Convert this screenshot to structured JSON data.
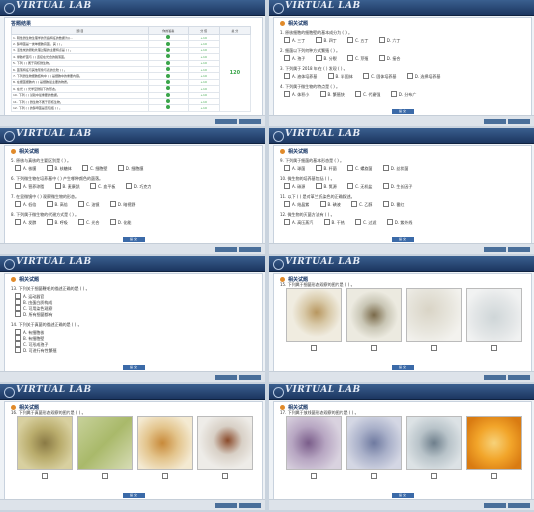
{
  "brand": {
    "logo_text": "VIRTUAL LAB"
  },
  "section_title": "相关试题",
  "submit_label": "提 交",
  "results": {
    "title": "答题结果",
    "headers": [
      "题 目",
      "你的答案",
      "分 值",
      "总 分"
    ],
    "rows": [
      "1. 阴性微生物生理学的普遍特征的数据为()...",
      "2. 酵母菌是一类单细胞真菌，其 ( ) 。",
      "3. 活性炭的颗粒处理过程的主要特点是 ( ) 。",
      "4. 绿脓杆菌与 ( ) 连接在光合的脱落菌。",
      "5. 下列 ( ) 属于真核微生物。",
      "6. 菌落特征与其他现象与表的比较 ( ) 。",
      "7. 下列微生物细胞结构中 ( ) 是细胞中的重要内容。",
      "8. 在细菌细胞内 ( ) 是细胞最主要的物质。",
      "9. 在光 ( ) 光学显微镜下的形态。",
      "10. 下列 ( ) 试验中最重要的数据。",
      "11. 下列 ( ) 微生物不属于原核生物。",
      "12. 下列 ( ) 的酵母菌是否包括 ( ) 。"
    ],
    "score_each": "+10",
    "total": "120"
  },
  "p2": {
    "questions": [
      {
        "text": "1. 原核细胞的细胞壁的基本成分为 ( ) 。",
        "options": [
          "A. 三丁",
          "B. 四丁",
          "C. 五丁",
          "D. 六丁"
        ]
      },
      {
        "text": "2. 细菌以下列何种方式繁殖 ( ) 。",
        "options": [
          "A. 孢子",
          "B. 分裂",
          "C. 芽殖",
          "D. 接合"
        ]
      },
      {
        "text": "3. 下列属于 2018 年在 ( ) 发现 ( ) 。",
        "options": [
          "A. 液体培养基",
          "B. 半固体",
          "C. 固体培养基",
          "D. 选择培养基"
        ]
      },
      {
        "text": "4. 下列属于微生物的特点是 ( ) 。",
        "options": [
          "A. 体积小",
          "B. 繁殖快",
          "C. 代谢强",
          "D. 分布广"
        ]
      }
    ]
  },
  "p3": {
    "questions": [
      {
        "text": "5. 原核与真核的主要区别是 ( ) 。",
        "options": [
          "A. 核膜",
          "B. 核糖体",
          "C. 细胞壁",
          "D. 细胞膜"
        ]
      },
      {
        "text": "6. 下列微生物在培养基中 ( ) 产生哪种颜色的菌落。",
        "options": [
          "A. 营养琼脂",
          "B. 麦康凯",
          "C. 血平板",
          "D. 巧克力"
        ]
      },
      {
        "text": "7. 在显微镜中 ( ) 观察微生物的形态。",
        "options": [
          "A. 低倍",
          "B. 高倍",
          "C. 油镜",
          "D. 暗视野"
        ]
      },
      {
        "text": "8. 下列属于微生物的代谢方式是 ( ) 。",
        "options": [
          "A. 发酵",
          "B. 呼吸",
          "C. 光合",
          "D. 化能"
        ]
      }
    ]
  },
  "p4": {
    "questions": [
      {
        "text": "9. 下列属于细菌的基本形态是 ( ) 。",
        "options": [
          "A. 球菌",
          "B. 杆菌",
          "C. 螺旋菌",
          "D. 丝状菌"
        ]
      },
      {
        "text": "10. 微生物的培养基包括 ( ) 。",
        "options": [
          "A. 碳源",
          "B. 氮源",
          "C. 无机盐",
          "D. 生长因子"
        ]
      },
      {
        "text": "11. 以下 ( ) 是对革兰氏染色的正确叙述。",
        "options": [
          "A. 结晶紫",
          "B. 碘液",
          "C. 乙醇",
          "D. 番红"
        ]
      },
      {
        "text": "12. 微生物的灭菌方法有 ( ) 。",
        "options": [
          "A. 高压蒸汽",
          "B. 干热",
          "C. 过滤",
          "D. 紫外线"
        ]
      }
    ]
  },
  "p5": {
    "questions": [
      {
        "text": "13. 下列关于细菌鞭毛的描述正确的是 ( ) 。",
        "options": [
          "A. 运动器官",
          "B. 由蛋白质构成",
          "C. 可用染色观察",
          "D. 所有细菌都有"
        ]
      },
      {
        "text": "14. 下列关于真菌的描述正确的是 ( ) 。",
        "options": [
          "A. 有细胞核",
          "B. 有细胞壁",
          "C. 可形成孢子",
          "D. 可进行有性繁殖"
        ]
      }
    ]
  },
  "p6": {
    "question": "15. 下列属于细菌形态观察的图片是 ( ) 。"
  },
  "p7": {
    "question": "16. 下列属于真菌形态观察的图片是 ( ) 。"
  },
  "p8": {
    "question": "17. 下列属于放线菌形态观察的图片是 ( ) 。"
  }
}
